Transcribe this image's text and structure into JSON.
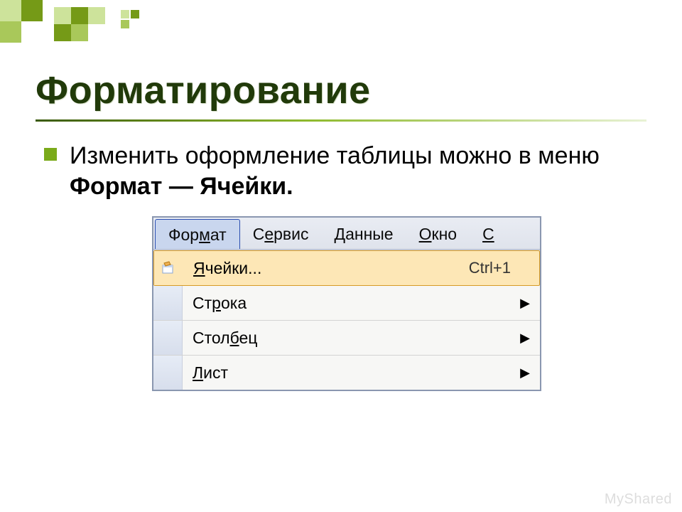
{
  "slide": {
    "title": "Форматирование",
    "bullet_prefix": "Изменить оформление таблицы можно в меню ",
    "bullet_bold": "Формат — Ячейки."
  },
  "menubar": {
    "items": [
      {
        "pre": "Фор",
        "u": "м",
        "post": "ат",
        "open": true
      },
      {
        "pre": "С",
        "u": "е",
        "post": "рвис",
        "open": false
      },
      {
        "pre": "",
        "u": "Д",
        "post": "анные",
        "open": false
      },
      {
        "pre": "",
        "u": "О",
        "post": "кно",
        "open": false
      },
      {
        "pre": "",
        "u": "С",
        "post": "",
        "open": false
      }
    ]
  },
  "dropdown": {
    "items": [
      {
        "u": "Я",
        "post": "чейки...",
        "shortcut": "Ctrl+1",
        "has_icon": true,
        "submenu": false,
        "highlight": true
      },
      {
        "u": "",
        "pre": "Ст",
        "mid_u": "р",
        "post": "ока",
        "shortcut": "",
        "has_icon": false,
        "submenu": true,
        "highlight": false
      },
      {
        "u": "",
        "pre": "Стол",
        "mid_u": "б",
        "post": "ец",
        "shortcut": "",
        "has_icon": false,
        "submenu": true,
        "highlight": false
      },
      {
        "u": "Л",
        "post": "ист",
        "shortcut": "",
        "has_icon": false,
        "submenu": true,
        "highlight": false
      }
    ]
  },
  "watermark": "MyShared"
}
